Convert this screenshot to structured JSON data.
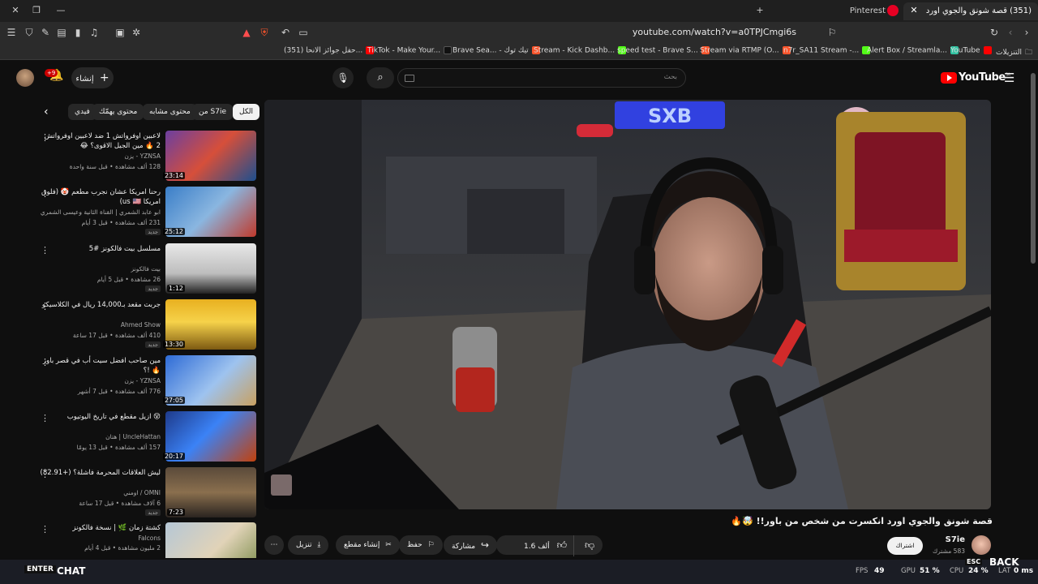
{
  "browser": {
    "tabs": [
      {
        "title": "(351) قصة شونق والجوي اورد",
        "active": true
      },
      {
        "title": "Pinterest",
        "active": false
      }
    ],
    "url": "youtube.com/watch?v=a0TPJCmgi6s",
    "bookmarks": [
      "(351) حفل جوائز الانحا...",
      "TikTok - Make Your...",
      "Brave Sea... - تيك توك",
      "Stream - Kick Dashb...",
      "speed test - Brave S...",
      "Stream via RTMP (O...",
      "n7r_SA11 Stream -...",
      "Alert Box / Streamla...",
      "YouTube",
      "التنزيلات"
    ]
  },
  "youtube": {
    "logo": "YouTube",
    "logo_region": "SA",
    "search_placeholder": "بحث",
    "create_label": "إنشاء",
    "notification_count": "+9",
    "chips": [
      {
        "label": "الكل",
        "active": true
      },
      {
        "label": "من S7ie",
        "active": false
      },
      {
        "label": "محتوى مشابه",
        "active": false
      },
      {
        "label": "محتوى يهمّك",
        "active": false
      },
      {
        "label": "فيدي",
        "active": false
      }
    ],
    "related": [
      {
        "title": "لاعبين اوفرواتش 1 ضد لاعبين اوفرواتش 2 🔥 مين الجيل الاقوى؟ 😂",
        "channel": "YZNSA - يزن",
        "meta": "128 ألف مشاهدة • قبل سنة واحدة",
        "duration": "23:14",
        "new": ""
      },
      {
        "title": "رحنا امريكا عشان نجرب مطعم 🤡 (فلوق امريكا us 🇺🇸)",
        "channel": "ابو عابد الشمري | القناة الثانية وعيسى الشمري",
        "meta": "231 ألف مشاهدة • قبل 3 أيام",
        "duration": "25:12",
        "new": "جديد"
      },
      {
        "title": "مسلسل بيت فالكونز #5",
        "channel": "بيت فالكونز",
        "meta": "26 مشاهدة • قبل 5 أيام",
        "duration": "1:12",
        "new": "جديد"
      },
      {
        "title": "جربت مقعد بـ14,000 ريال في الكلاسيكو",
        "channel": "Ahmed Show",
        "meta": "410 ألف مشاهدة • قبل 17 ساعة",
        "duration": "13:30",
        "new": "جديد"
      },
      {
        "title": "مين صاحب افضل سيت أب في قصر باور 🔥 !؟",
        "channel": "YZNSA - يزن",
        "meta": "776 ألف مشاهدة • قبل 7 أشهر",
        "duration": "27:05",
        "new": ""
      },
      {
        "title": "😵 ازيل مقطع في تاريخ اليوتيوب",
        "channel": "UncleHattan | هتان",
        "meta": "157 ألف مشاهدة • قبل 13 يومًا",
        "duration": "20:17",
        "new": ""
      },
      {
        "title": "ليش العلاقات المحرمة فاشلة؟ (+82.91)",
        "channel": "OMNI / اومني",
        "meta": "6 آلاف مشاهدة • قبل 17 ساعة",
        "duration": "7:23",
        "new": "جديد"
      },
      {
        "title": "كشتة زمان 🌿 | نسخة فالكونز",
        "channel": "Falcons",
        "meta": "2 مليون مشاهدة • قبل 4 أيام",
        "duration": "",
        "new": ""
      }
    ],
    "video": {
      "title": "قصة شونق والجوي اورد انكسرت من شخص من باور!! 🤯🔥",
      "channel": "S7ie",
      "subscribers": "583 مشترك",
      "subscribe_label": "اشتراك",
      "likes": "1.6 ألف",
      "share": "مشاركة",
      "save": "حفظ",
      "clip": "إنشاء مقطع",
      "download": "تنزيل"
    }
  },
  "overlay": {
    "enter": "ENTER",
    "chat": "CHAT",
    "fps_label": "FPS",
    "fps": "49",
    "gpu_label": "GPU",
    "gpu": "51 %",
    "cpu_label": "CPU",
    "cpu": "24 %",
    "lat_label": "LAT",
    "lat": "0 ms",
    "esc": "ESC",
    "back": "BACK"
  }
}
